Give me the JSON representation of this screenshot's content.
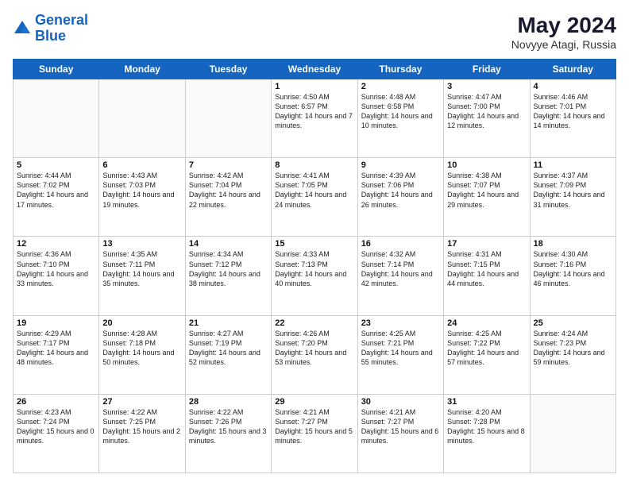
{
  "header": {
    "logo_line1": "General",
    "logo_line2": "Blue",
    "main_title": "May 2024",
    "subtitle": "Novyye Atagi, Russia"
  },
  "days_of_week": [
    "Sunday",
    "Monday",
    "Tuesday",
    "Wednesday",
    "Thursday",
    "Friday",
    "Saturday"
  ],
  "weeks": [
    [
      {
        "num": "",
        "info": ""
      },
      {
        "num": "",
        "info": ""
      },
      {
        "num": "",
        "info": ""
      },
      {
        "num": "1",
        "info": "Sunrise: 4:50 AM\nSunset: 6:57 PM\nDaylight: 14 hours\nand 7 minutes."
      },
      {
        "num": "2",
        "info": "Sunrise: 4:48 AM\nSunset: 6:58 PM\nDaylight: 14 hours\nand 10 minutes."
      },
      {
        "num": "3",
        "info": "Sunrise: 4:47 AM\nSunset: 7:00 PM\nDaylight: 14 hours\nand 12 minutes."
      },
      {
        "num": "4",
        "info": "Sunrise: 4:46 AM\nSunset: 7:01 PM\nDaylight: 14 hours\nand 14 minutes."
      }
    ],
    [
      {
        "num": "5",
        "info": "Sunrise: 4:44 AM\nSunset: 7:02 PM\nDaylight: 14 hours\nand 17 minutes."
      },
      {
        "num": "6",
        "info": "Sunrise: 4:43 AM\nSunset: 7:03 PM\nDaylight: 14 hours\nand 19 minutes."
      },
      {
        "num": "7",
        "info": "Sunrise: 4:42 AM\nSunset: 7:04 PM\nDaylight: 14 hours\nand 22 minutes."
      },
      {
        "num": "8",
        "info": "Sunrise: 4:41 AM\nSunset: 7:05 PM\nDaylight: 14 hours\nand 24 minutes."
      },
      {
        "num": "9",
        "info": "Sunrise: 4:39 AM\nSunset: 7:06 PM\nDaylight: 14 hours\nand 26 minutes."
      },
      {
        "num": "10",
        "info": "Sunrise: 4:38 AM\nSunset: 7:07 PM\nDaylight: 14 hours\nand 29 minutes."
      },
      {
        "num": "11",
        "info": "Sunrise: 4:37 AM\nSunset: 7:09 PM\nDaylight: 14 hours\nand 31 minutes."
      }
    ],
    [
      {
        "num": "12",
        "info": "Sunrise: 4:36 AM\nSunset: 7:10 PM\nDaylight: 14 hours\nand 33 minutes."
      },
      {
        "num": "13",
        "info": "Sunrise: 4:35 AM\nSunset: 7:11 PM\nDaylight: 14 hours\nand 35 minutes."
      },
      {
        "num": "14",
        "info": "Sunrise: 4:34 AM\nSunset: 7:12 PM\nDaylight: 14 hours\nand 38 minutes."
      },
      {
        "num": "15",
        "info": "Sunrise: 4:33 AM\nSunset: 7:13 PM\nDaylight: 14 hours\nand 40 minutes."
      },
      {
        "num": "16",
        "info": "Sunrise: 4:32 AM\nSunset: 7:14 PM\nDaylight: 14 hours\nand 42 minutes."
      },
      {
        "num": "17",
        "info": "Sunrise: 4:31 AM\nSunset: 7:15 PM\nDaylight: 14 hours\nand 44 minutes."
      },
      {
        "num": "18",
        "info": "Sunrise: 4:30 AM\nSunset: 7:16 PM\nDaylight: 14 hours\nand 46 minutes."
      }
    ],
    [
      {
        "num": "19",
        "info": "Sunrise: 4:29 AM\nSunset: 7:17 PM\nDaylight: 14 hours\nand 48 minutes."
      },
      {
        "num": "20",
        "info": "Sunrise: 4:28 AM\nSunset: 7:18 PM\nDaylight: 14 hours\nand 50 minutes."
      },
      {
        "num": "21",
        "info": "Sunrise: 4:27 AM\nSunset: 7:19 PM\nDaylight: 14 hours\nand 52 minutes."
      },
      {
        "num": "22",
        "info": "Sunrise: 4:26 AM\nSunset: 7:20 PM\nDaylight: 14 hours\nand 53 minutes."
      },
      {
        "num": "23",
        "info": "Sunrise: 4:25 AM\nSunset: 7:21 PM\nDaylight: 14 hours\nand 55 minutes."
      },
      {
        "num": "24",
        "info": "Sunrise: 4:25 AM\nSunset: 7:22 PM\nDaylight: 14 hours\nand 57 minutes."
      },
      {
        "num": "25",
        "info": "Sunrise: 4:24 AM\nSunset: 7:23 PM\nDaylight: 14 hours\nand 59 minutes."
      }
    ],
    [
      {
        "num": "26",
        "info": "Sunrise: 4:23 AM\nSunset: 7:24 PM\nDaylight: 15 hours\nand 0 minutes."
      },
      {
        "num": "27",
        "info": "Sunrise: 4:22 AM\nSunset: 7:25 PM\nDaylight: 15 hours\nand 2 minutes."
      },
      {
        "num": "28",
        "info": "Sunrise: 4:22 AM\nSunset: 7:26 PM\nDaylight: 15 hours\nand 3 minutes."
      },
      {
        "num": "29",
        "info": "Sunrise: 4:21 AM\nSunset: 7:27 PM\nDaylight: 15 hours\nand 5 minutes."
      },
      {
        "num": "30",
        "info": "Sunrise: 4:21 AM\nSunset: 7:27 PM\nDaylight: 15 hours\nand 6 minutes."
      },
      {
        "num": "31",
        "info": "Sunrise: 4:20 AM\nSunset: 7:28 PM\nDaylight: 15 hours\nand 8 minutes."
      },
      {
        "num": "",
        "info": ""
      }
    ]
  ]
}
